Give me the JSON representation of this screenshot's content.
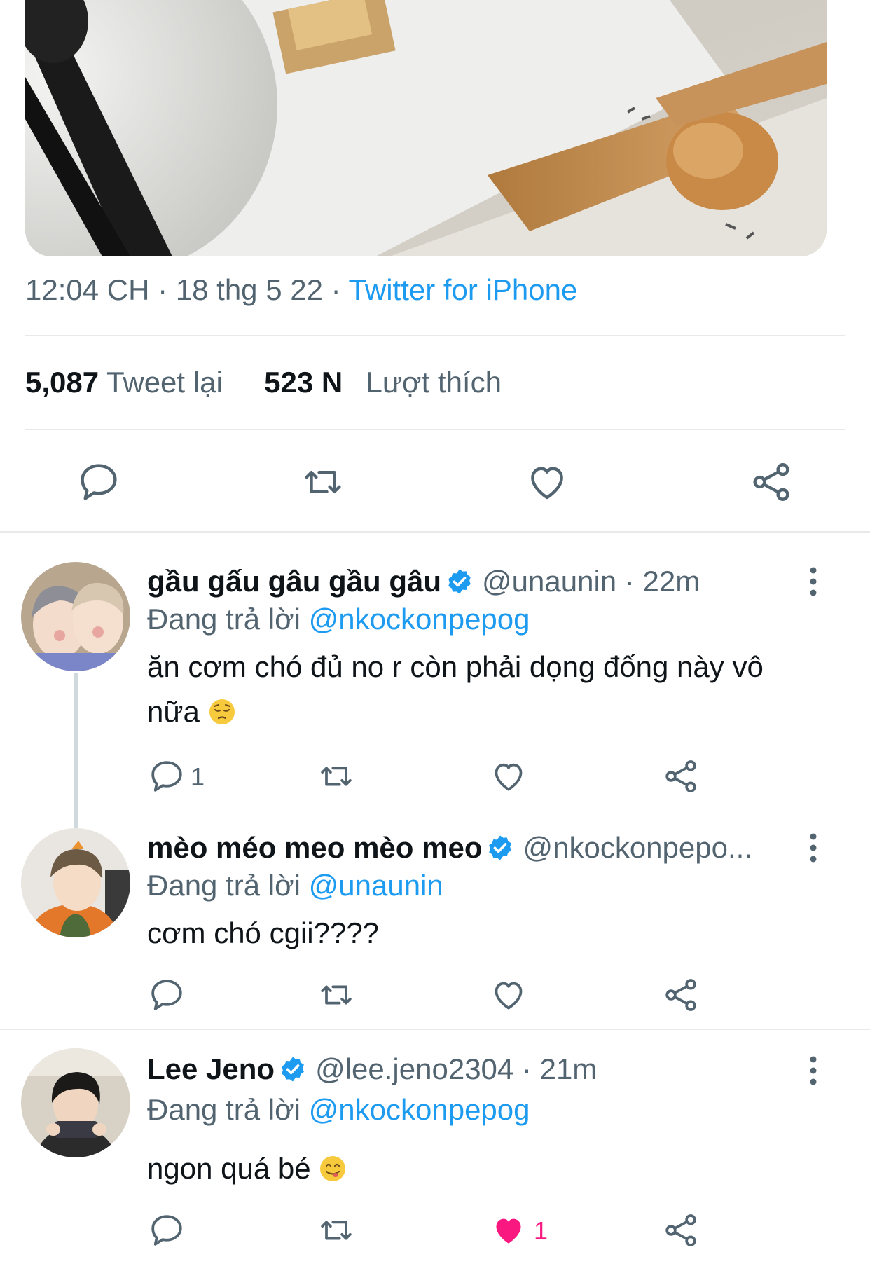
{
  "tweet": {
    "time": "12:04 CH",
    "date": "18 thg 5 22",
    "source": "Twitter for iPhone",
    "retweet_count": "5,087",
    "retweet_label": "Tweet lại",
    "like_count": "523 N",
    "like_label": "Lượt thích"
  },
  "replies": [
    {
      "name": "gầu gấu gâu gầu gâu",
      "handle_time": "@unaunin · 22m",
      "replying_label": "Đang trả lời",
      "replying_to": "@nkockonpepog",
      "text_line1": "ăn cơm chó đủ no r còn phải dọng đống này vô",
      "text_line2": "nữa",
      "emoji": "pensive-face-emoji",
      "reply_count": "1"
    },
    {
      "name": "mèo méo meo mèo meo",
      "handle_time": "@nkockonpepo...",
      "replying_label": "Đang trả lời",
      "replying_to": "@unaunin",
      "text": "cơm chó cgii????"
    },
    {
      "name": "Lee Jeno",
      "handle_time": "@lee.jeno2304 · 21m",
      "replying_label": "Đang trả lời",
      "replying_to": "@nkockonpepog",
      "text": "ngon quá bé",
      "emoji": "yum-face-emoji",
      "like_count": "1",
      "liked": true
    }
  ],
  "colors": {
    "accent": "#1d9bf0",
    "like": "#f91880",
    "muted": "#536471"
  }
}
